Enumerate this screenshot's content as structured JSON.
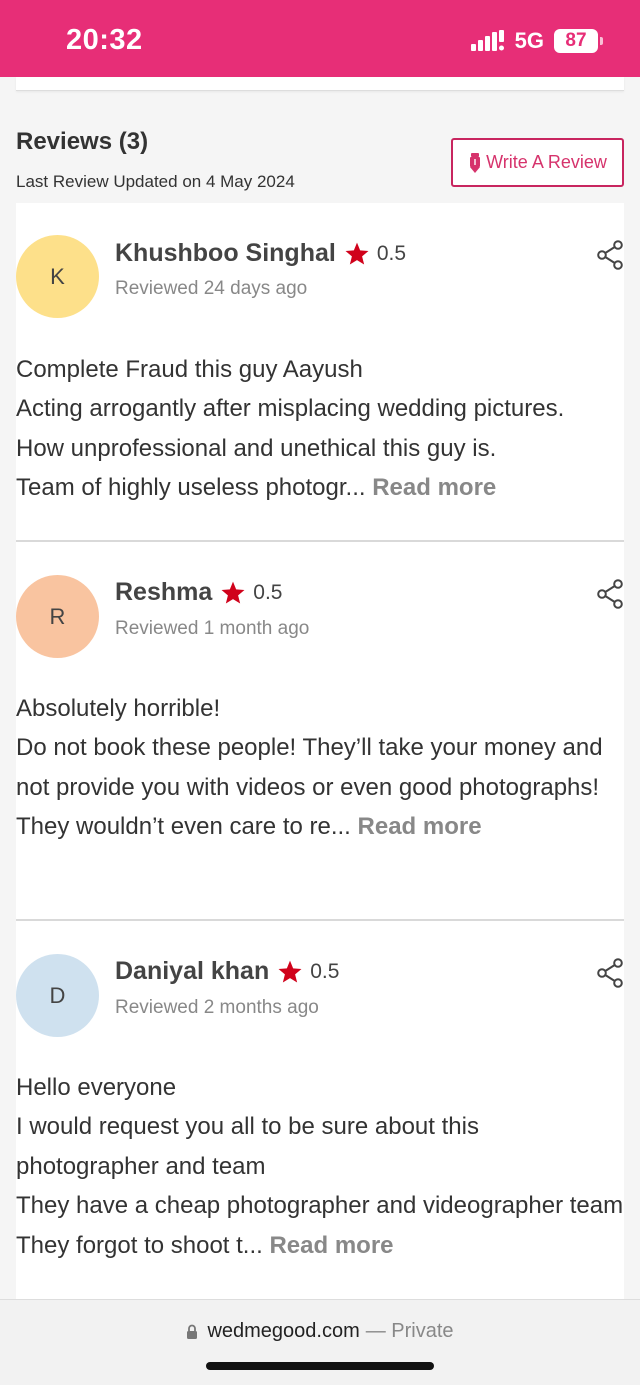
{
  "status_bar": {
    "time": "20:32",
    "network": "5G",
    "battery": "87",
    "background_color": "#e72e77"
  },
  "reviews_section": {
    "title": "Reviews (3)",
    "last_updated": "Last Review Updated on 4 May 2024",
    "write_review_label": "Write A Review",
    "write_review_icon": "pen-icon",
    "accent_color": "#d6336c"
  },
  "reviews": [
    {
      "initial": "K",
      "avatar_color": "#fde08a",
      "name": "Khushboo Singhal",
      "rating": "0.5",
      "reviewed": "Reviewed 24 days ago",
      "lines": [
        "Complete Fraud this guy Aayush",
        "Acting arrogantly after misplacing wedding pictures.",
        "How unprofessional and unethical this guy is.",
        "Team of highly useless photogr..."
      ],
      "read_more": "Read more"
    },
    {
      "initial": "R",
      "avatar_color": "#f9c4a0",
      "name": "Reshma",
      "rating": "0.5",
      "reviewed": "Reviewed 1 month ago",
      "lines": [
        "Absolutely horrible!",
        "Do not book these people! They’ll take your money and not provide you with videos or even good photographs!",
        "They wouldn’t even care to re..."
      ],
      "read_more": "Read more"
    },
    {
      "initial": "D",
      "avatar_color": "#cfe1ef",
      "name": "Daniyal khan",
      "rating": "0.5",
      "reviewed": "Reviewed 2 months ago",
      "lines": [
        "Hello everyone",
        "I would request you all to be sure about this photographer and team",
        "They have a cheap photographer and videographer team",
        "They forgot to shoot t..."
      ],
      "read_more": "Read more"
    }
  ],
  "star_color": "#d0021b",
  "browser_bar": {
    "domain": "wedmegood.com",
    "suffix": "— Private"
  }
}
